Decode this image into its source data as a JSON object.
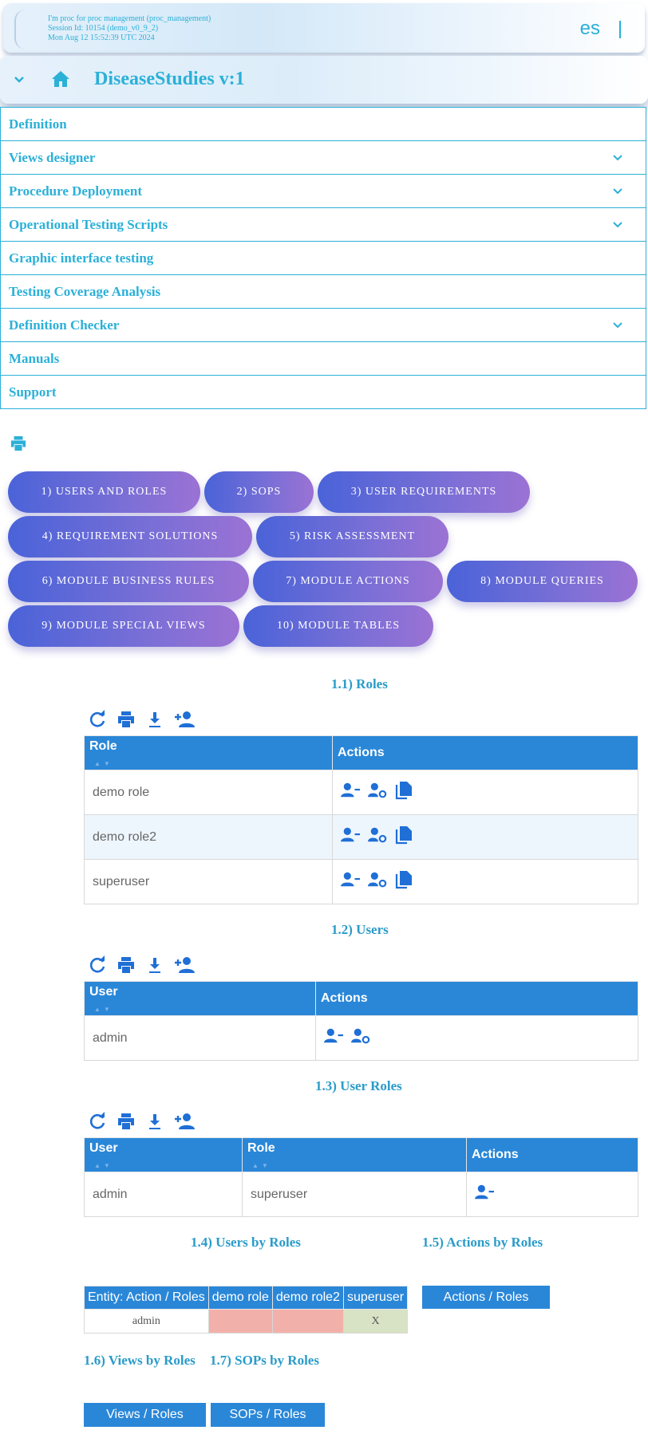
{
  "header": {
    "session_line1": "I'm proc for proc management (proc_management)",
    "session_line2": "Session Id: 10154 (demo_v0_9_2)",
    "session_line3": "Mon Aug 12 15:52:39 UTC 2024",
    "language": "es"
  },
  "app": {
    "title": "DiseaseStudies v:1"
  },
  "menu": {
    "items": [
      {
        "label": "Definition"
      },
      {
        "label": "Views designer"
      },
      {
        "label": "Procedure Deployment"
      },
      {
        "label": "Operational Testing Scripts"
      },
      {
        "label": "Graphic interface testing"
      },
      {
        "label": "Testing Coverage Analysis"
      },
      {
        "label": "Definition Checker"
      },
      {
        "label": "Manuals"
      },
      {
        "label": "Support"
      }
    ]
  },
  "tabs": [
    "1) USERS AND ROLES",
    "2) SOPS",
    "3) USER REQUIREMENTS",
    "4) REQUIREMENT SOLUTIONS",
    "5) RISK ASSESSMENT",
    "6) MODULE BUSINESS RULES",
    "7) MODULE ACTIONS",
    "8) MODULE QUERIES",
    "9) MODULE SPECIAL VIEWS",
    "10) MODULE TABLES"
  ],
  "roles": {
    "title": "1.1) Roles",
    "col_role": "Role",
    "col_actions": "Actions",
    "rows": [
      "demo role",
      "demo role2",
      "superuser"
    ]
  },
  "users": {
    "title": "1.2) Users",
    "col_user": "User",
    "col_actions": "Actions",
    "rows": [
      "admin"
    ]
  },
  "user_roles": {
    "title": "1.3) User Roles",
    "col_user": "User",
    "col_role": "Role",
    "col_actions": "Actions",
    "rows": [
      {
        "user": "admin",
        "role": "superuser"
      }
    ]
  },
  "users_by_roles": {
    "title": "1.4) Users by Roles",
    "header_entity": "Entity: Action / Roles",
    "columns": [
      "demo role",
      "demo role2",
      "superuser"
    ],
    "row_label": "admin",
    "cell_superuser": "X"
  },
  "actions_by_roles": {
    "title": "1.5) Actions by Roles",
    "button": "Actions / Roles"
  },
  "views_by_roles": {
    "title": "1.6) Views by Roles",
    "button": "Views / Roles"
  },
  "sops_by_roles": {
    "title": "1.7) SOPs by Roles",
    "button": "SOPs / Roles"
  },
  "colors": {
    "accent": "#2bb0d8",
    "table_header": "#2a87d8",
    "icon_blue": "#1f6fd6",
    "tab_start": "#4a63d8",
    "tab_end": "#9b72d4"
  }
}
